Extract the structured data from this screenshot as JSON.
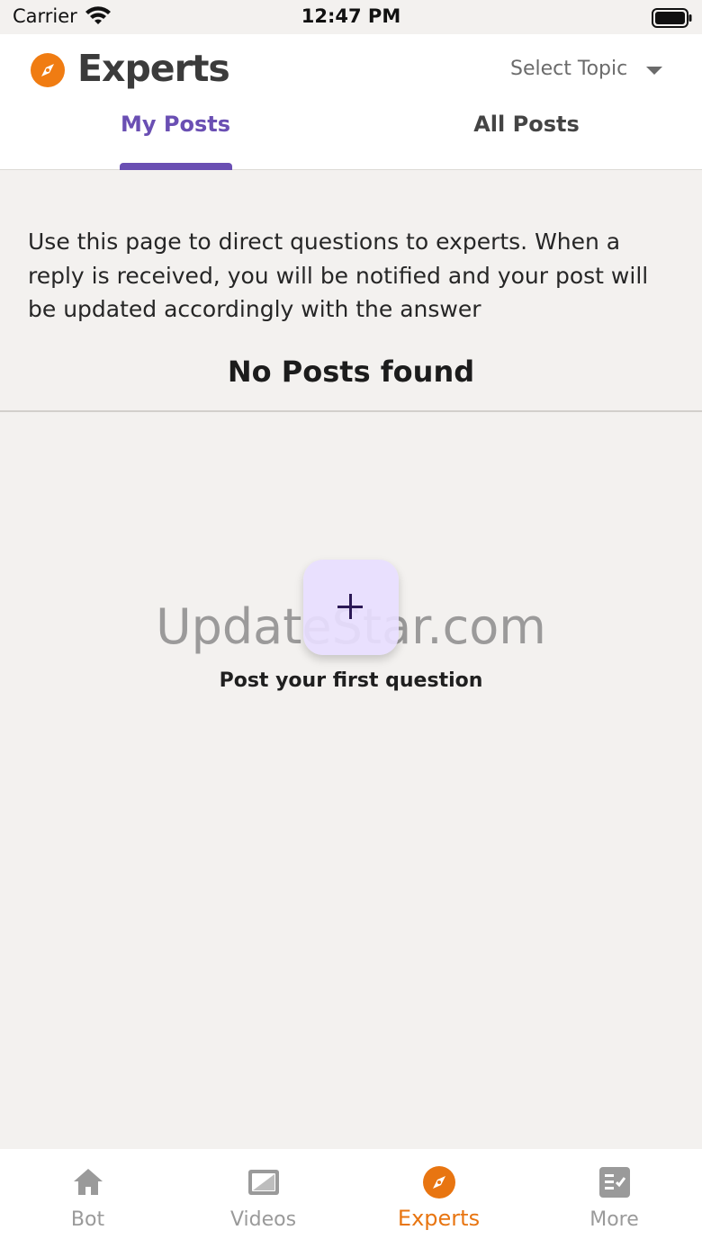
{
  "status_bar": {
    "carrier": "Carrier",
    "time": "12:47 PM"
  },
  "header": {
    "title": "Experts",
    "logo_icon": "compass-icon",
    "topic_select": {
      "label": "Select Topic",
      "icon": "caret-down-icon"
    },
    "tabs": [
      {
        "label": "My Posts",
        "active": true
      },
      {
        "label": "All Posts",
        "active": false
      }
    ]
  },
  "main": {
    "intro": "Use this page to direct questions to experts. When a reply is received, you will be notified and your post will be updated accordingly with the answer",
    "empty_title": "No Posts found",
    "add_button": {
      "icon": "plus-icon"
    },
    "add_caption": "Post your first question",
    "watermark": "UpdateStar.com"
  },
  "bottom_nav": {
    "items": [
      {
        "label": "Bot",
        "icon": "home-icon",
        "active": false
      },
      {
        "label": "Videos",
        "icon": "video-icon",
        "active": false
      },
      {
        "label": "Experts",
        "icon": "compass-icon",
        "active": true
      },
      {
        "label": "More",
        "icon": "checklist-icon",
        "active": false
      }
    ]
  },
  "colors": {
    "accent_purple": "#6a4fb3",
    "accent_orange": "#e87511",
    "background": "#f3f1ef",
    "add_button_fill": "#e8deff"
  }
}
